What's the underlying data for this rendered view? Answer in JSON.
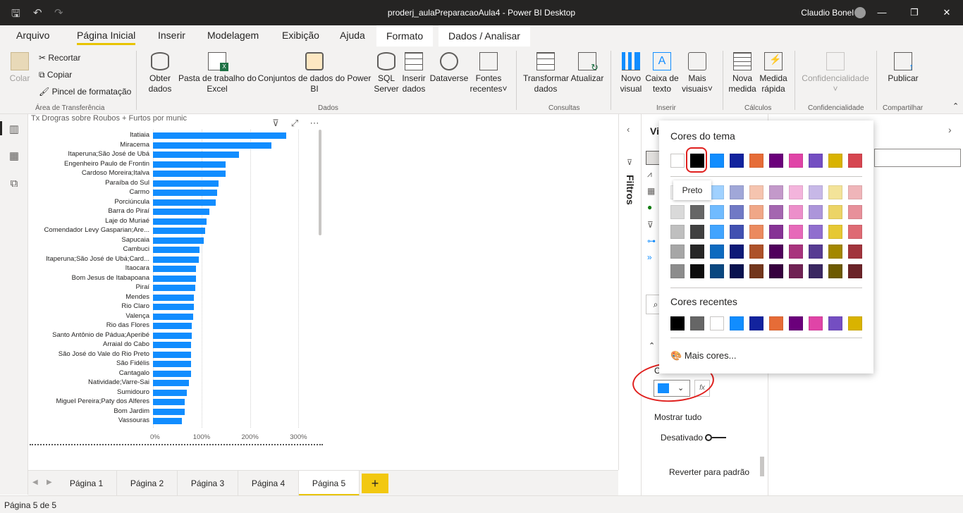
{
  "window": {
    "title": "proderj_aulaPreparacaoAula4 - Power BI Desktop",
    "user": "Claudio Bonel"
  },
  "tabs": [
    "Arquivo",
    "Página Inicial",
    "Inserir",
    "Modelagem",
    "Exibição",
    "Ajuda",
    "Formato",
    "Dados / Analisar"
  ],
  "ribbon": {
    "clipboard": {
      "paste": "Colar",
      "cut": "Recortar",
      "copy": "Copiar",
      "format_painter": "Pincel de formatação",
      "group": "Área de Transferência"
    },
    "data": {
      "get_data": "Obter",
      "get_data2": "dados",
      "excel": "Pasta de trabalho do",
      "excel2": "Excel",
      "datasets": "Conjuntos de dados do Power",
      "datasets2": "BI",
      "sql": "SQL",
      "sql2": "Server",
      "enter": "Inserir",
      "enter2": "dados",
      "dataverse": "Dataverse",
      "recent": "Fontes",
      "recent2": "recentes",
      "group": "Dados"
    },
    "queries": {
      "transform": "Transformar",
      "transform2": "dados",
      "refresh": "Atualizar",
      "group": "Consultas"
    },
    "insert": {
      "new_visual": "Novo",
      "new_visual2": "visual",
      "textbox": "Caixa de",
      "textbox2": "texto",
      "more": "Mais",
      "more2": "visuais",
      "group": "Inserir"
    },
    "calc": {
      "measure": "Nova",
      "measure2": "medida",
      "quick": "Medida",
      "quick2": "rápida",
      "group": "Cálculos"
    },
    "sensitivity": {
      "label": "Confidencialidade",
      "group": "Confidencialidade"
    },
    "share": {
      "publish": "Publicar",
      "group": "Compartilhar"
    }
  },
  "visual": {
    "title": "Tx Drogras sobre Roubos + Furtos por munic"
  },
  "chart_data": {
    "type": "bar",
    "orientation": "horizontal",
    "title": "Tx Drogras sobre Roubos + Furtos por munic",
    "categories": [
      "Itatiaia",
      "Miracema",
      "Itaperuna;São José de Ubá",
      "Engenheiro Paulo de Frontin",
      "Cardoso Moreira;Italva",
      "Paraíba do Sul",
      "Carmo",
      "Porciúncula",
      "Barra do Piraí",
      "Laje do Muriaé",
      "Comendador Levy Gasparian;Are...",
      "Sapucaia",
      "Cambuci",
      "Itaperuna;São José de Ubá;Card...",
      "Itaocara",
      "Bom Jesus de Itabapoana",
      "Piraí",
      "Mendes",
      "Rio Claro",
      "Valença",
      "Rio das Flores",
      "Santo Antônio de Pádua;Aperibé",
      "Arraial do Cabo",
      "São José do Vale do Rio Preto",
      "São Fidélis",
      "Cantagalo",
      "Natividade;Varre-Sai",
      "Sumidouro",
      "Miguel Pereira;Paty dos Alferes",
      "Bom Jardim",
      "Vassouras"
    ],
    "values": [
      275,
      245,
      178,
      150,
      150,
      135,
      132,
      130,
      117,
      110,
      108,
      105,
      96,
      94,
      89,
      88,
      87,
      85,
      84,
      83,
      80,
      80,
      79,
      79,
      78,
      78,
      74,
      70,
      66,
      65,
      59
    ],
    "xlim": [
      0,
      320
    ],
    "xticks": [
      "0%",
      "100%",
      "200%",
      "300%"
    ],
    "xtick_values": [
      0,
      100,
      200,
      300
    ],
    "color": "#118dff"
  },
  "pages": [
    "Página 1",
    "Página 2",
    "Página 3",
    "Página 4",
    "Página 5"
  ],
  "add_page": "+",
  "status": "Página 5 de 5",
  "filters_label": "Filtros",
  "viz_pane": {
    "header": "Vi",
    "show_all": "Mostrar tudo",
    "toggle": "Desativado",
    "reset": "Reverter para padrão",
    "color_label": "C",
    "fx": "fx"
  },
  "color_picker": {
    "theme_header": "Cores do tema",
    "recent_header": "Cores recentes",
    "more": "Mais cores...",
    "tooltip": "Preto",
    "theme_row": [
      "#ffffff",
      "#000000",
      "#118dff",
      "#12239e",
      "#e66c37",
      "#6b007b",
      "#e044a7",
      "#744ec2",
      "#d9b300",
      "#d64550"
    ],
    "shades": [
      [
        "#f2f2f2",
        "#808080",
        "#a0d1ff",
        "#a0a7d8",
        "#f5c4af",
        "#c399ca",
        "#f3b4dc",
        "#c7b8e7",
        "#f3e399",
        "#efb5b9"
      ],
      [
        "#d9d9d9",
        "#666666",
        "#70bbff",
        "#7079c5",
        "#f0a787",
        "#a466b0",
        "#ec8fca",
        "#ac95da",
        "#ecd466",
        "#e7909a"
      ],
      [
        "#bfbfbf",
        "#404040",
        "#41a4ff",
        "#4150b1",
        "#eb8a5f",
        "#863395",
        "#e669b9",
        "#906ece",
        "#e6c833",
        "#de6a73"
      ],
      [
        "#a6a6a6",
        "#262626",
        "#0d6abf",
        "#0e1a77",
        "#ad5129",
        "#50005c",
        "#a8337d",
        "#573b92",
        "#a38700",
        "#a1343c"
      ],
      [
        "#8c8c8c",
        "#0d0d0d",
        "#094780",
        "#09124f",
        "#73361c",
        "#36003e",
        "#702254",
        "#3a2761",
        "#6d5a00",
        "#6b2328"
      ]
    ],
    "recent": [
      "#000000",
      "#666666",
      "#ffffff",
      "#118dff",
      "#12239e",
      "#e66c37",
      "#6b007b",
      "#e044a7",
      "#744ec2",
      "#d9b300"
    ],
    "current": "#118dff"
  }
}
